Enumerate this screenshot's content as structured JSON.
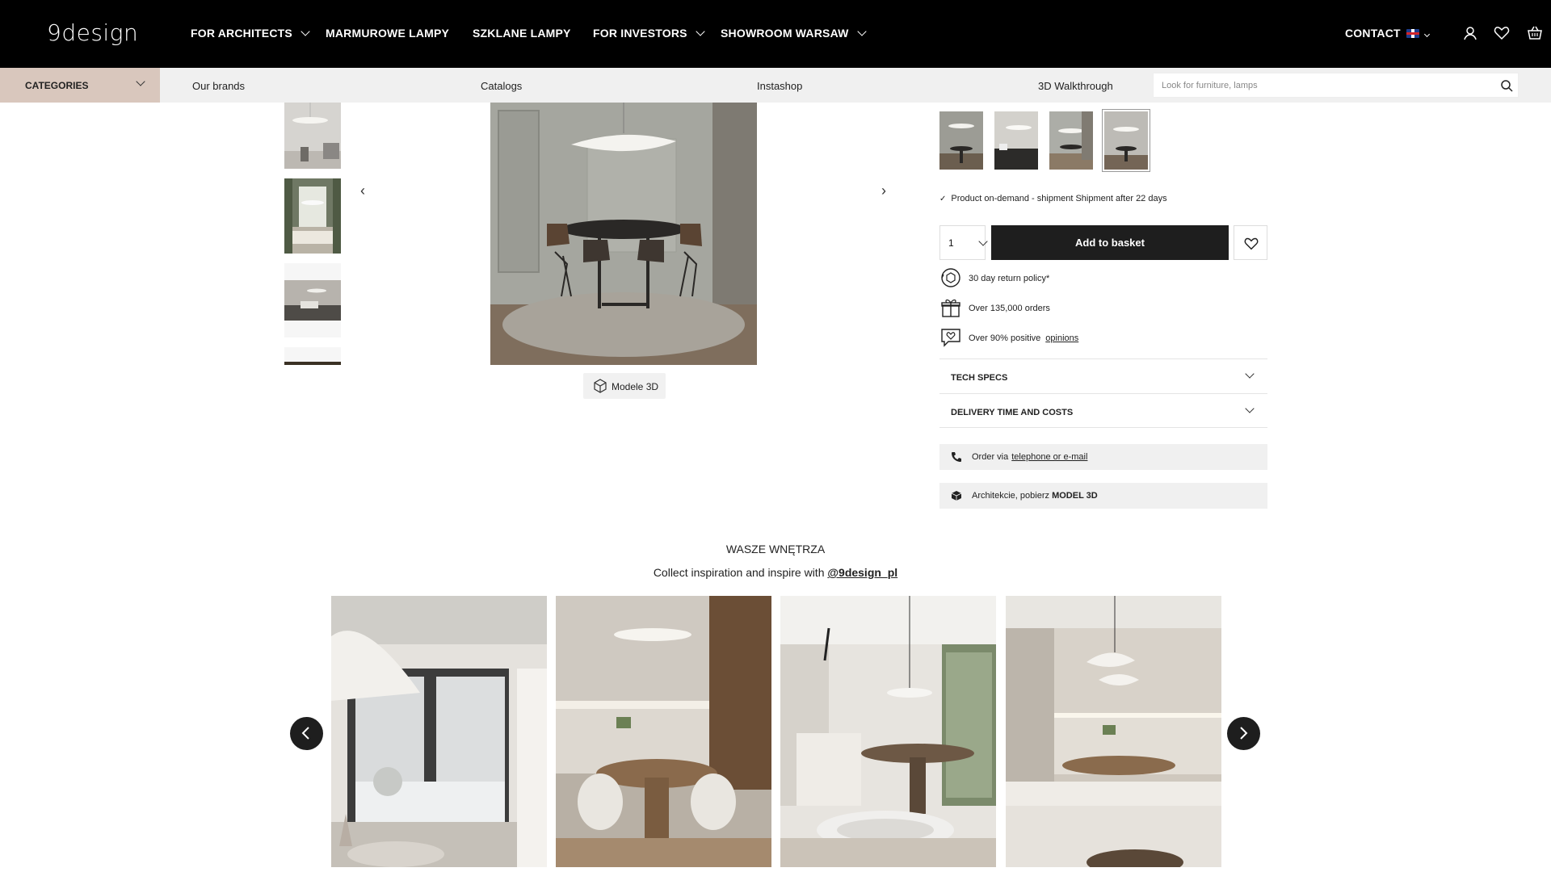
{
  "header": {
    "logo": "9design",
    "nav": [
      {
        "label": "FOR ARCHITECTS",
        "has_dropdown": true
      },
      {
        "label": "MARMUROWE LAMPY",
        "has_dropdown": false
      },
      {
        "label": "SZKLANE LAMPY",
        "has_dropdown": false
      },
      {
        "label": "FOR INVESTORS",
        "has_dropdown": true
      },
      {
        "label": "SHOWROOM WARSAW",
        "has_dropdown": true
      }
    ],
    "contact_label": "CONTACT",
    "language_icon": "uk-flag-icon",
    "icons": [
      "user-icon",
      "heart-icon",
      "basket-icon"
    ]
  },
  "subnav": {
    "categories_label": "CATEGORIES",
    "links": [
      "Our brands",
      "Catalogs",
      "Instashop",
      "3D Walkthrough"
    ],
    "search_placeholder": "Look for furniture, lamps"
  },
  "product": {
    "models_3d_label": "Modele 3D",
    "availability": "Product on-demand - shipment Shipment after 22 days",
    "quantity": "1",
    "add_to_basket_label": "Add to basket",
    "features": [
      {
        "icon": "return-icon",
        "text": "30 day return policy*",
        "link": ""
      },
      {
        "icon": "gift-icon",
        "text": "Over 135,000 orders",
        "link": ""
      },
      {
        "icon": "heart-chat-icon",
        "text": "Over 90% positive",
        "link": "opinions"
      }
    ],
    "accordions": [
      "TECH SPECS",
      "DELIVERY TIME AND COSTS"
    ],
    "order_via": {
      "text": "Order via",
      "link": "telephone or e-mail"
    },
    "architects": {
      "text": "Architekcie, pobierz",
      "bold": "MODEL 3D"
    }
  },
  "inspiration": {
    "title": "WASZE WNĘTRZA",
    "subtitle": "Collect inspiration and inspire with",
    "handle": "@9design_pl"
  },
  "colors": {
    "topbar": "#000000",
    "categories_bg": "#d9c7bd",
    "subnav_bg": "#f0f0f0",
    "button_dark": "#1e1e1e"
  }
}
